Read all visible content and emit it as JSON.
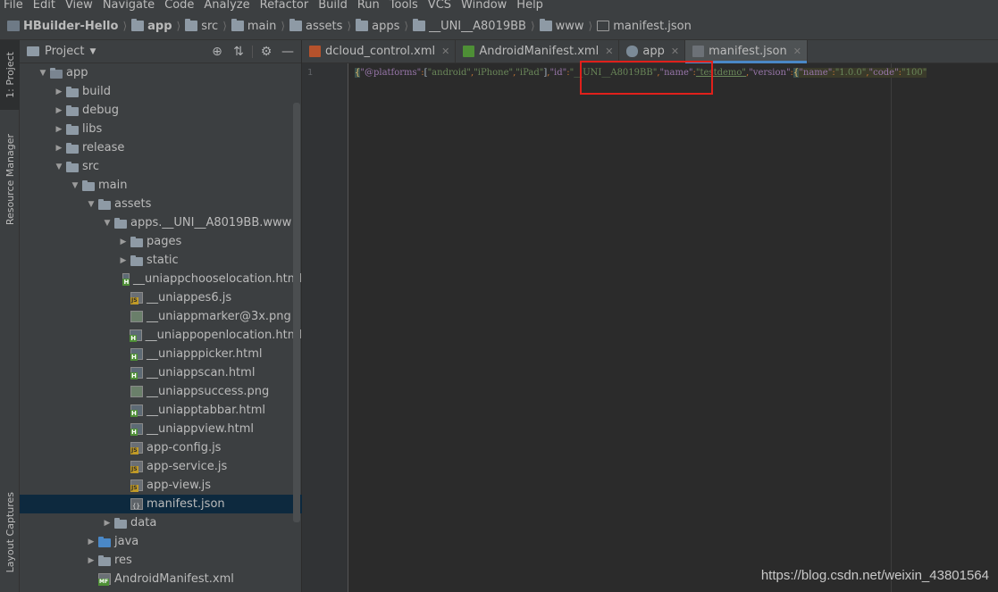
{
  "menu": [
    "File",
    "Edit",
    "View",
    "Navigate",
    "Code",
    "Analyze",
    "Refactor",
    "Build",
    "Run",
    "Tools",
    "VCS",
    "Window",
    "Help"
  ],
  "breadcrumb": [
    {
      "label": "HBuilder-Hello",
      "icon": "project-icon",
      "bold": true
    },
    {
      "label": "app",
      "icon": "module-folder-icon",
      "bold": true
    },
    {
      "label": "src",
      "icon": "folder-icon",
      "bold": false
    },
    {
      "label": "main",
      "icon": "folder-icon",
      "bold": false
    },
    {
      "label": "assets",
      "icon": "assets-folder-icon",
      "bold": false
    },
    {
      "label": "apps",
      "icon": "folder-icon",
      "bold": false
    },
    {
      "label": "__UNI__A8019BB",
      "icon": "folder-icon",
      "bold": false
    },
    {
      "label": "www",
      "icon": "folder-icon",
      "bold": false
    },
    {
      "label": "manifest.json",
      "icon": "json-file-icon",
      "bold": false
    }
  ],
  "left_strip": {
    "project_tab": "1: Project",
    "resource_tab": "Resource Manager",
    "layout_tab": "Layout Captures"
  },
  "project_panel": {
    "title": "Project",
    "tree": [
      {
        "label": "app",
        "depth": 1,
        "arrow": "open",
        "icon": "app"
      },
      {
        "label": "build",
        "depth": 2,
        "arrow": "closed",
        "icon": "folder"
      },
      {
        "label": "debug",
        "depth": 2,
        "arrow": "closed",
        "icon": "folder"
      },
      {
        "label": "libs",
        "depth": 2,
        "arrow": "closed",
        "icon": "folder"
      },
      {
        "label": "release",
        "depth": 2,
        "arrow": "closed",
        "icon": "folder"
      },
      {
        "label": "src",
        "depth": 2,
        "arrow": "open",
        "icon": "folder"
      },
      {
        "label": "main",
        "depth": 3,
        "arrow": "open",
        "icon": "folder"
      },
      {
        "label": "assets",
        "depth": 4,
        "arrow": "open",
        "icon": "folder"
      },
      {
        "label": "apps.__UNI__A8019BB.www",
        "depth": 5,
        "arrow": "open",
        "icon": "folder"
      },
      {
        "label": "pages",
        "depth": 6,
        "arrow": "closed",
        "icon": "folder"
      },
      {
        "label": "static",
        "depth": 6,
        "arrow": "closed",
        "icon": "folder"
      },
      {
        "label": "__uniappchooselocation.html",
        "depth": 6,
        "arrow": "none",
        "icon": "html"
      },
      {
        "label": "__uniappes6.js",
        "depth": 6,
        "arrow": "none",
        "icon": "js"
      },
      {
        "label": "__uniappmarker@3x.png",
        "depth": 6,
        "arrow": "none",
        "icon": "png"
      },
      {
        "label": "__uniappopenlocation.html",
        "depth": 6,
        "arrow": "none",
        "icon": "html"
      },
      {
        "label": "__uniapppicker.html",
        "depth": 6,
        "arrow": "none",
        "icon": "html"
      },
      {
        "label": "__uniappscan.html",
        "depth": 6,
        "arrow": "none",
        "icon": "html"
      },
      {
        "label": "__uniappsuccess.png",
        "depth": 6,
        "arrow": "none",
        "icon": "png"
      },
      {
        "label": "__uniapptabbar.html",
        "depth": 6,
        "arrow": "none",
        "icon": "html"
      },
      {
        "label": "__uniappview.html",
        "depth": 6,
        "arrow": "none",
        "icon": "html"
      },
      {
        "label": "app-config.js",
        "depth": 6,
        "arrow": "none",
        "icon": "js"
      },
      {
        "label": "app-service.js",
        "depth": 6,
        "arrow": "none",
        "icon": "js"
      },
      {
        "label": "app-view.js",
        "depth": 6,
        "arrow": "none",
        "icon": "js"
      },
      {
        "label": "manifest.json",
        "depth": 6,
        "arrow": "none",
        "icon": "json",
        "selected": true
      },
      {
        "label": "data",
        "depth": 5,
        "arrow": "closed",
        "icon": "folder"
      },
      {
        "label": "java",
        "depth": 4,
        "arrow": "closed",
        "icon": "folder-blue"
      },
      {
        "label": "res",
        "depth": 4,
        "arrow": "closed",
        "icon": "folder"
      },
      {
        "label": "AndroidManifest.xml",
        "depth": 4,
        "arrow": "none",
        "icon": "xml"
      }
    ]
  },
  "tabs": [
    {
      "label": "dcloud_control.xml",
      "icon": "xml-file-icon",
      "active": false
    },
    {
      "label": "AndroidManifest.xml",
      "icon": "manifest-file-icon",
      "active": false
    },
    {
      "label": "app",
      "icon": "gradle-icon",
      "active": false
    },
    {
      "label": "manifest.json",
      "icon": "json-file-icon",
      "active": true
    }
  ],
  "editor": {
    "line_number": "1",
    "code": {
      "open_brace": "{",
      "k_platforms": "\"@platforms\"",
      "v_platforms_open": "[",
      "p1": "\"android\"",
      "p2": "\"iPhone\"",
      "p3": "\"iPad\"",
      "v_platforms_close": "]",
      "k_id": "\"id\"",
      "v_id": "\"__UNI__A8019BB\"",
      "k_name": "\"name\"",
      "v_name": "\"testdemo\"",
      "k_version": "\"version\"",
      "k_vname": "\"name\"",
      "v_vname": "\"1.0.0\"",
      "k_code": "\"code\"",
      "v_code": "\"100\""
    }
  },
  "watermark": "https://blog.csdn.net/weixin_43801564",
  "colors": {
    "highlight_box": "#e0201b",
    "selection": "#0d293e",
    "active_tab_underline": "#4a88c7"
  }
}
